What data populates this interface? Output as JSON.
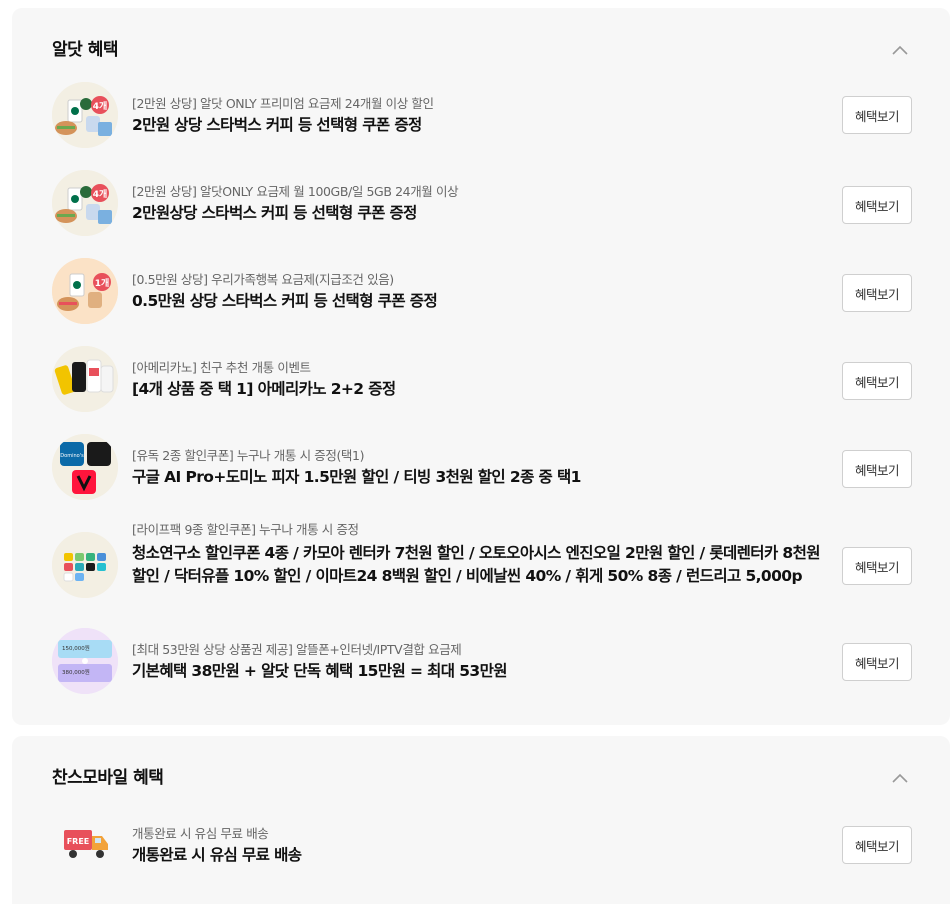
{
  "sections": [
    {
      "title": "알닷 혜택",
      "items": [
        {
          "subtitle": "[2만원 상당] 알닷 ONLY 프리미엄 요금제 24개월 이상 할인",
          "title": "2만원 상당 스타벅스 커피 등 선택형 쿠폰 증정",
          "button": "혜택보기",
          "badge": "4개"
        },
        {
          "subtitle": "[2만원 상당] 알닷ONLY 요금제 월 100GB/일 5GB 24개월 이상",
          "title": "2만원상당 스타벅스 커피 등 선택형 쿠폰 증정",
          "button": "혜택보기",
          "badge": "4개"
        },
        {
          "subtitle": "[0.5만원 상당] 우리가족행복 요금제(지급조건 있음)",
          "title": "0.5만원 상당 스타벅스 커피 등 선택형 쿠폰 증정",
          "button": "혜택보기",
          "badge": "1개"
        },
        {
          "subtitle": "[아메리카노] 친구 추천 개통 이벤트",
          "title": "[4개 상품 중 택 1] 아메리카노 2+2 증정",
          "button": "혜택보기"
        },
        {
          "subtitle": "[유독 2종 할인쿠폰] 누구나 개통 시 증정(택1)",
          "title": "구글 AI Pro+도미노 피자 1.5만원 할인 / 티빙 3천원 할인 2종 중 택1",
          "button": "혜택보기",
          "logo_text": "Domino's"
        },
        {
          "subtitle": "[라이프팩 9종 할인쿠폰] 누구나 개통 시 증정",
          "title": "청소연구소 할인쿠폰 4종 / 카모아 렌터카 7천원 할인 / 오토오아시스 엔진오일 2만원 할인 / 롯데렌터카 8천원 할인 / 닥터유플 10% 할인 / 이마트24 8백원 할인 / 비에날씬 40% / 휘게 50% 8종 / 런드리고 5,000p",
          "button": "혜택보기"
        },
        {
          "subtitle": "[최대 53만원 상당 상품권 제공] 알뜰폰+인터넷/IPTV결합 요금제",
          "title": "기본혜택 38만원 + 알닷 단독 혜택 15만원 = 최대 53만원",
          "button": "혜택보기",
          "card1": "150,000원",
          "card2": "380,000원"
        }
      ]
    },
    {
      "title": "찬스모바일 혜택",
      "items": [
        {
          "subtitle": "개통완료 시 유심 무료 배송",
          "title": "개통완료 시 유심 무료 배송",
          "button": "혜택보기",
          "truck_label": "FREE"
        }
      ]
    }
  ],
  "colors": {
    "section_bg": "#f7f7f7",
    "badge": "#e8505b",
    "truck": "#e8505b",
    "tving": "#ff153c",
    "domino": "#0b6aa8",
    "starbucks": "#00704a"
  },
  "icons": {
    "collapse": "chevron-up-icon"
  }
}
